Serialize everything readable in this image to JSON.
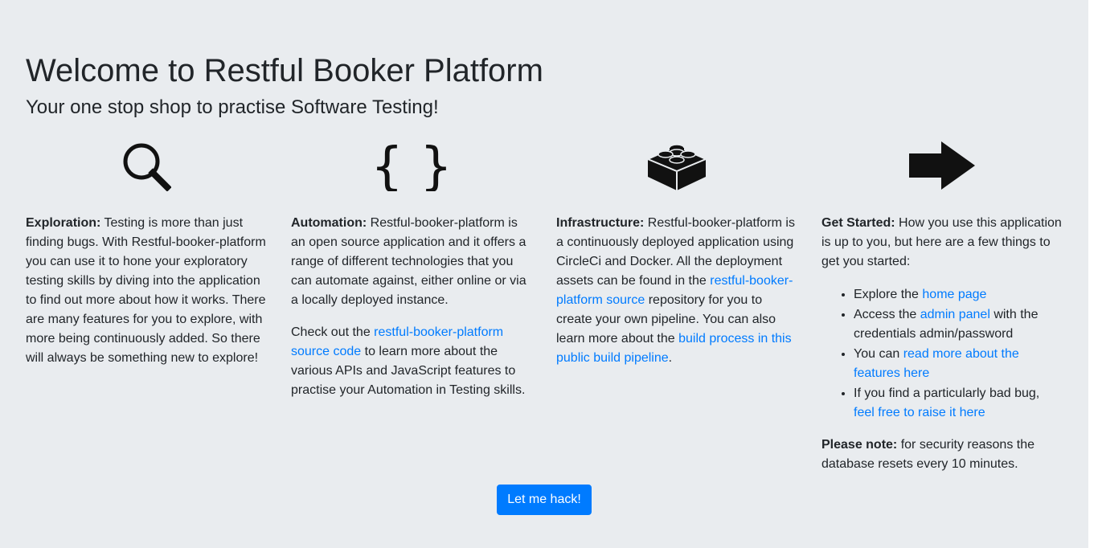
{
  "header": {
    "title": "Welcome to Restful Booker Platform",
    "subtitle": "Your one stop shop to practise Software Testing!"
  },
  "columns": [
    {
      "icon": "search-icon",
      "heading": "Exploration:",
      "text": " Testing is more than just finding bugs. With Restful-booker-platform you can use it to hone your exploratory testing skills by diving into the application to find out more about how it works. There are many features for you to explore, with more being continuously added. So there will always be something new to explore!"
    },
    {
      "icon": "curly-braces-icon",
      "heading": "Automation:",
      "text": " Restful-booker-platform is an open source application and it offers a range of different technologies that you can automate against, either online or via a locally deployed instance.",
      "p2_before": "Check out the ",
      "p2_link": "restful-booker-platform source code",
      "p2_after": " to learn more about the various APIs and JavaScript features to practise your Automation in Testing skills."
    },
    {
      "icon": "lego-brick-icon",
      "heading": "Infrastructure:",
      "text_before": " Restful-booker-platform is a continuously deployed application using CircleCi and Docker. All the deployment assets can be found in the ",
      "link1": "restful-booker-platform source",
      "text_middle": " repository for you to create your own pipeline. You can also learn more about the ",
      "link2": "build process in this public build pipeline",
      "text_after": "."
    },
    {
      "icon": "arrow-right-icon",
      "heading": "Get Started:",
      "text": " How you use this application is up to you, but here are a few things to get you started:",
      "items": [
        {
          "before": "Explore the ",
          "link": "home page",
          "after": ""
        },
        {
          "before": "Access the ",
          "link": "admin panel",
          "after": " with the credentials admin/password"
        },
        {
          "before": "You can ",
          "link": "read more about the features here",
          "after": ""
        },
        {
          "before": "If you find a particularly bad bug, ",
          "link": "feel free to raise it here",
          "after": ""
        }
      ],
      "note_heading": "Please note:",
      "note_text": " for security reasons the database resets every 10 minutes."
    }
  ],
  "cta": {
    "label": "Let me hack!"
  },
  "colors": {
    "background": "#e9ecef",
    "link": "#007bff",
    "button": "#007bff",
    "text": "#212529"
  }
}
